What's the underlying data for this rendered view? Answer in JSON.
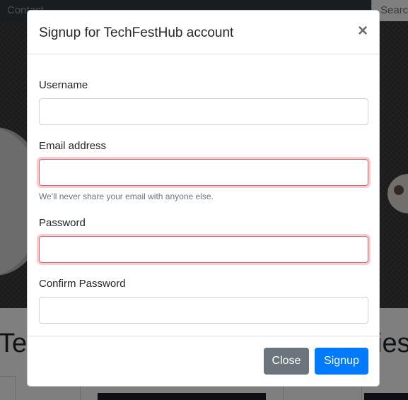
{
  "background": {
    "navbar": {
      "link": "Contact",
      "search_button": "Search"
    },
    "section_heading_left": "Tec",
    "section_heading_right": "ies"
  },
  "modal": {
    "title": "Signup for TechFestHub account",
    "close_icon": "×",
    "fields": {
      "username": {
        "label": "Username",
        "value": ""
      },
      "email": {
        "label": "Email address",
        "value": "",
        "help": "We'll never share your email with anyone else."
      },
      "password": {
        "label": "Password",
        "value": ""
      },
      "confirm_password": {
        "label": "Confirm Password",
        "value": ""
      }
    },
    "footer": {
      "close_label": "Close",
      "signup_label": "Signup"
    }
  },
  "colors": {
    "primary": "#007bff",
    "secondary": "#6c757d",
    "invalid": "#dc3545"
  }
}
